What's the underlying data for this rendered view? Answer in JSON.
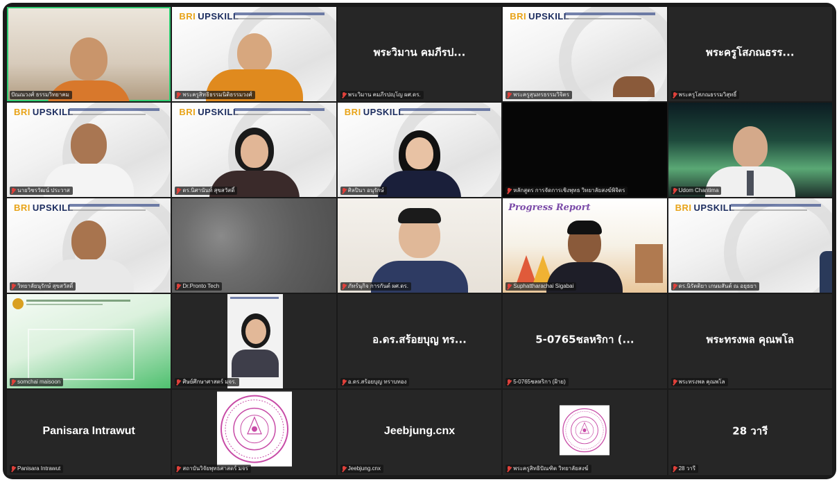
{
  "participants": [
    {
      "name": "ปัณณวงศ์ ธรรมวิทยาคม",
      "display": ""
    },
    {
      "name": "พระครูสิทธิธรรมนิติธรรมวงศ์",
      "display": ""
    },
    {
      "name": "พระวิมาน คมภีรปญฺโญ ผศ.ดร.",
      "display": "พระวิมาน คมภีรป..."
    },
    {
      "name": "พระครูสุนทรธรรมวิจิตร",
      "display": ""
    },
    {
      "name": "พระครูโสภณธรรมวิสุทธิ์",
      "display": "พระครูโสภณธรร..."
    },
    {
      "name": "นายวิชรวัฒน์ ประวาส",
      "display": ""
    },
    {
      "name": "ดร.นิศานันท์ สุขสวัสดิ์",
      "display": ""
    },
    {
      "name": "ศิลปินา อนุรักษ์",
      "display": ""
    },
    {
      "name": "หลักสูตร การจัดการเชิงพุทธ วิทยาลัยสงฆ์พิจิตร",
      "display": ""
    },
    {
      "name": "Udom Chantima",
      "display": ""
    },
    {
      "name": "วิทยาลัยนุรักษ์ สุขสวัสดิ์",
      "display": ""
    },
    {
      "name": "Dr.Pronto Tech",
      "display": ""
    },
    {
      "name": "ภัทร์นุกิจ การกันต์ ผศ.ดร.",
      "display": ""
    },
    {
      "name": "Suphattharachai Sigabai",
      "display": ""
    },
    {
      "name": "ดร.นิรัตติยา เกษมสันต์ ณ อยุธยา",
      "display": ""
    },
    {
      "name": "somchai maisoon",
      "display": ""
    },
    {
      "name": "ศิษย์ศึกษาศาสตร์ มจร.",
      "display": ""
    },
    {
      "name": "อ.ดร.สร้อยบุญ ทราบทอง",
      "display": "อ.ดร.สร้อยบุญ ทร..."
    },
    {
      "name": "5-0765ชลหริกา (ฝ้าย)",
      "display": "5-0765ชลหริกา (..."
    },
    {
      "name": "พระทรงพล คุณพโล",
      "display": "พระทรงพล คุณพโล"
    },
    {
      "name": "Panisara Intrawut",
      "display": "Panisara Intrawut"
    },
    {
      "name": "สถาบันวิจัยพุทธศาสตร์ มจร",
      "display": ""
    },
    {
      "name": "Jeebjung.cnx",
      "display": "Jeebjung.cnx"
    },
    {
      "name": "พระครูสิทธิปัณฑิต วิทยาลัยสงฆ์",
      "display": ""
    },
    {
      "name": "28 วารี",
      "display": "28 วารี"
    }
  ],
  "branding": {
    "logo_text": "UPSKILL",
    "logo_prefix": "BRI",
    "progress_slide_title": "Progress Report"
  },
  "colors": {
    "active_speaker": "#2ecc71",
    "muted_mic": "#e0403a",
    "tile_bg": "#262626",
    "frame_bg": "#1a1a1a"
  }
}
